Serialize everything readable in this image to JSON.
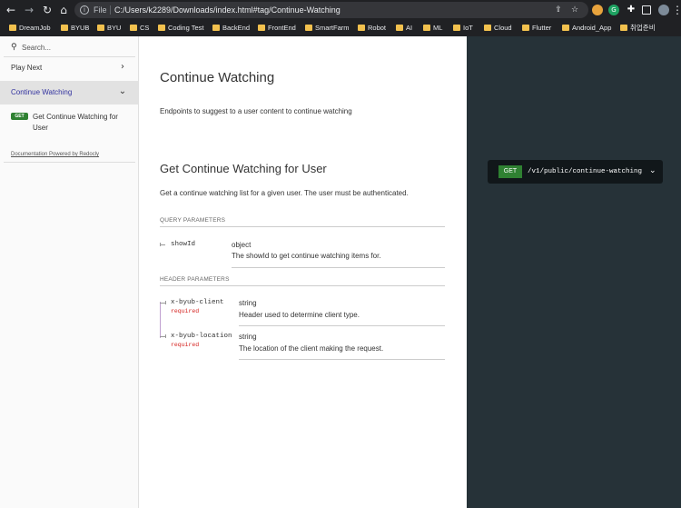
{
  "browser": {
    "file_label": "File",
    "url": "C:/Users/k2289/Downloads/index.html#tag/Continue-Watching",
    "bookmarks": [
      "DreamJob",
      "BYUB",
      "BYU",
      "CS",
      "Coding Test",
      "BackEnd",
      "FrontEnd",
      "SmartFarm",
      "Robot",
      "AI",
      "ML",
      "IoT",
      "Cloud",
      "Flutter",
      "Android_App",
      "취업준비"
    ]
  },
  "sidebar": {
    "search_placeholder": "Search...",
    "items": [
      {
        "label": "Play Next"
      },
      {
        "label": "Continue Watching"
      }
    ],
    "operation": {
      "method": "GET",
      "label": "Get Continue Watching for User"
    },
    "powered_by": "Documentation Powered by Redocly"
  },
  "main": {
    "title": "Continue Watching",
    "description": "Endpoints to suggest to a user content to continue watching",
    "operation_title": "Get Continue Watching for User",
    "operation_description": "Get a continue watching list for a given user. The user must be authenticated.",
    "query_section": "QUERY PARAMETERS",
    "query_params": [
      {
        "name": "showId",
        "type": "object",
        "description": "The showId to get continue watching items for."
      }
    ],
    "header_section": "HEADER PARAMETERS",
    "header_params": [
      {
        "name": "x-byub-client",
        "required": "required",
        "type": "string",
        "description": "Header used to determine client type."
      },
      {
        "name": "x-byub-location",
        "required": "required",
        "type": "string",
        "description": "The location of the client making the request."
      }
    ]
  },
  "right": {
    "method": "GET",
    "path": "/v1/public/continue-watching"
  },
  "colors": {
    "accent": "#32329f",
    "get_green": "#2f8132",
    "right_panel": "#263238",
    "required_red": "#d41f1c"
  }
}
